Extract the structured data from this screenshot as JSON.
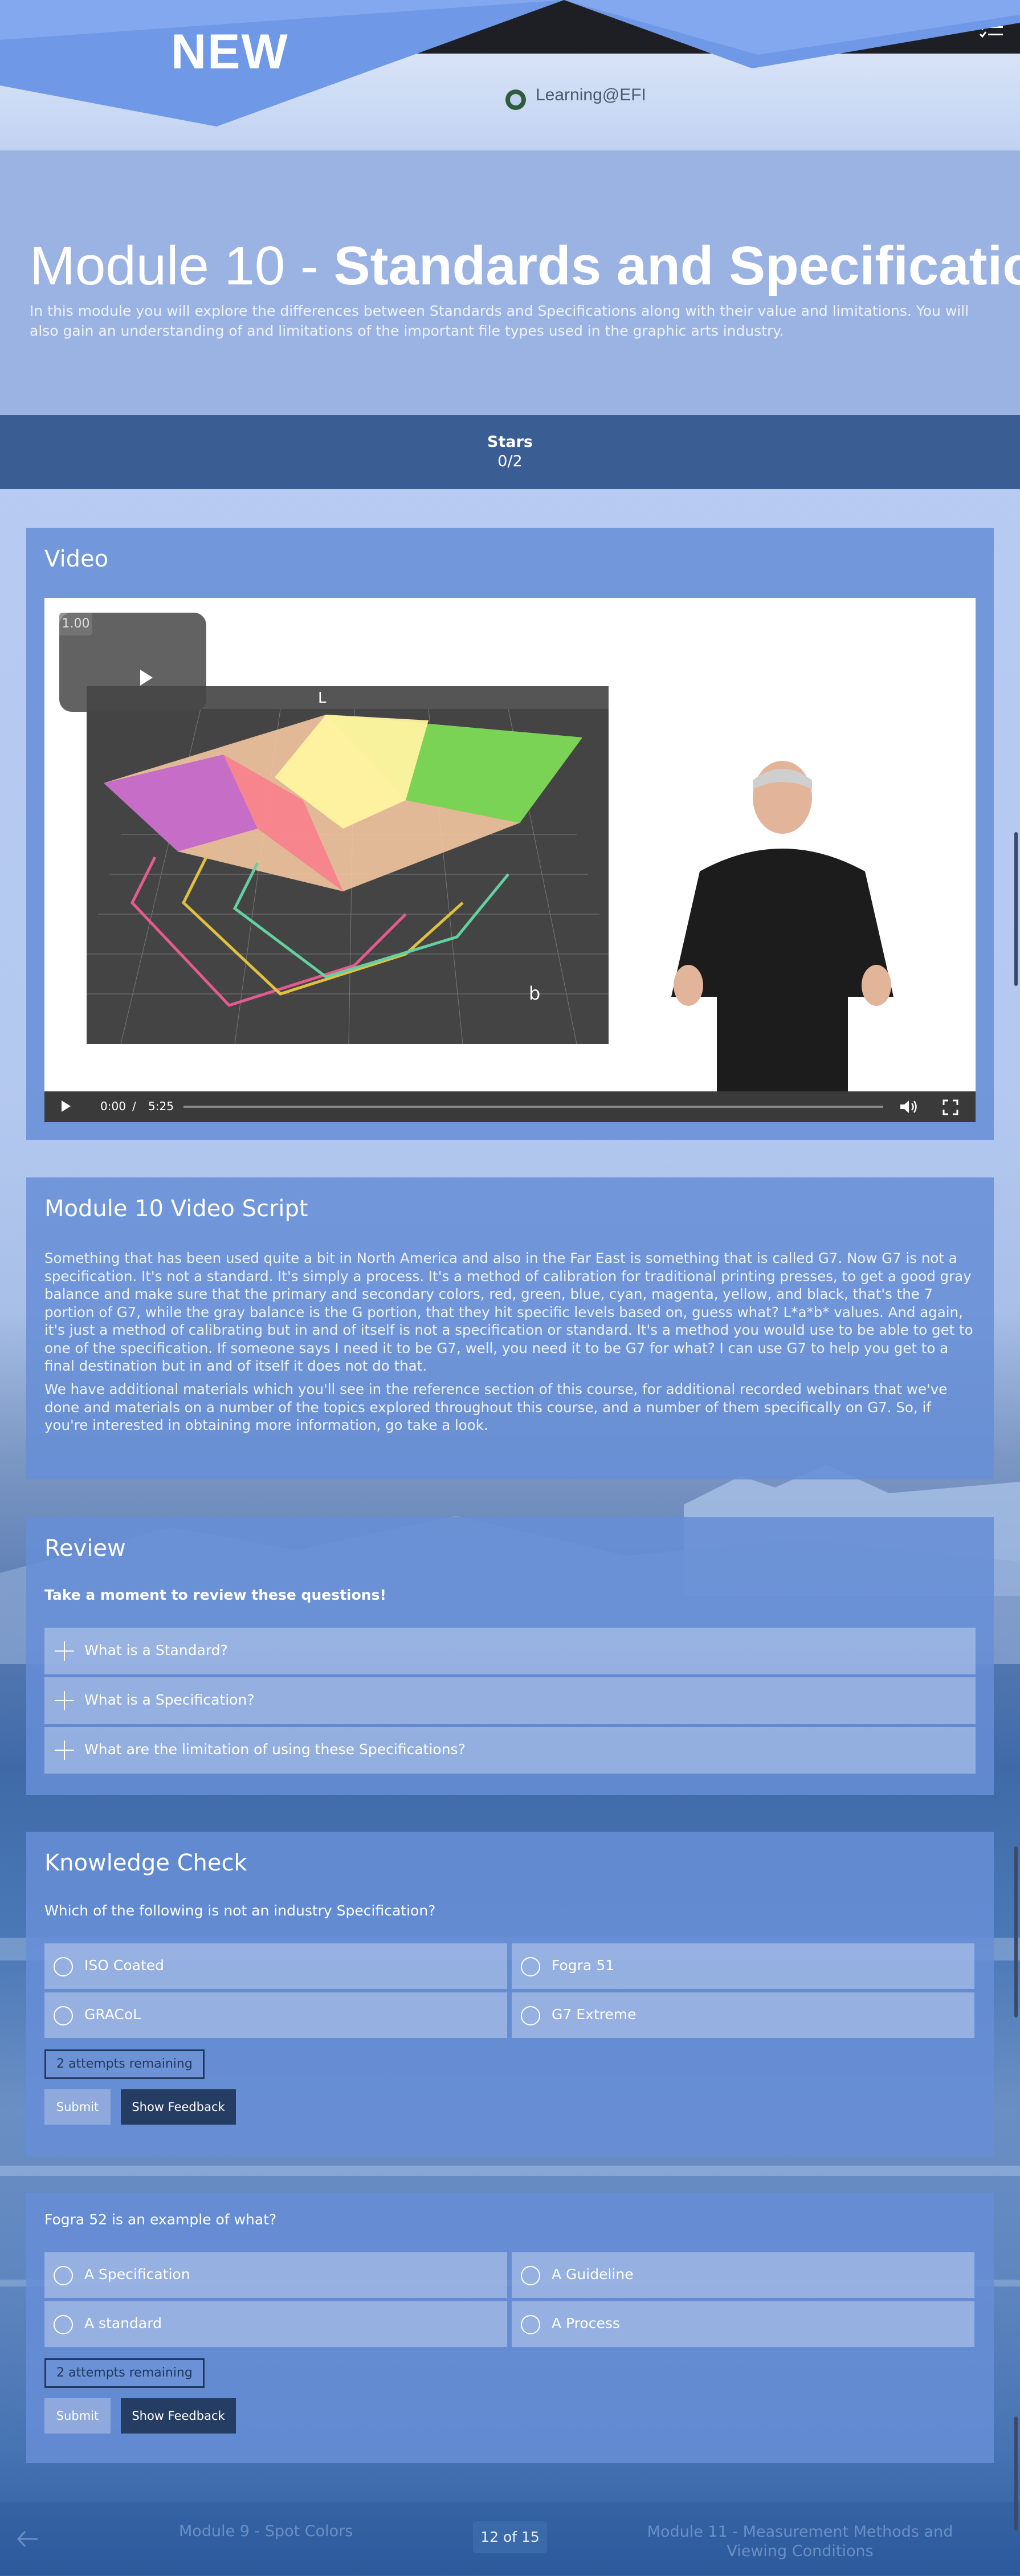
{
  "banner": {
    "label": "NEW"
  },
  "header": {
    "logo_text": "Learning@EFI"
  },
  "hero": {
    "title_prefix": "Module 10 - ",
    "title_main": "Standards and Specification",
    "description": "In this module you will explore the differences between Standards and Specifications along with their value and limitations. You will also gain an understanding of and limitations of the important file types used in the graphic arts industry."
  },
  "stars": {
    "label": "Stars",
    "value": "0/2"
  },
  "video": {
    "title": "Video",
    "speed": "1.00",
    "gamut_axis_top": "L",
    "gamut_axis_right": "b",
    "current_time": "0:00",
    "separator": "/",
    "duration": "5:25",
    "progress": 0
  },
  "script": {
    "title": "Module 10 Video Script",
    "paragraphs": [
      "Something that has been used quite a bit in North America and also in the Far East is something that is called G7. Now G7 is not a specification. It's not a standard. It's simply a process. It's a method of calibration for traditional printing presses, to get a good gray balance and make sure that the primary and secondary colors, red, green, blue, cyan, magenta, yellow, and black, that's the 7 portion of G7, while the gray balance is the G portion, that they hit specific levels based on, guess what? L*a*b* values. And again, it's just a method of calibrating but in and of itself is not a specification or standard. It's a method you would use to be able to get to one of the specification. If someone says I need it to be G7, well, you need it to be G7 for what? I can use G7 to help you get to a final destination but in and of itself it does not do that.",
      "We have additional materials which you'll see in the reference section of this course, for additional recorded webinars that we've done and materials on a number of the topics explored throughout this course, and a number of them specifically on G7. So, if you're interested in obtaining more information, go take a look."
    ]
  },
  "review": {
    "title": "Review",
    "intro": "Take a moment to review these questions!",
    "items": [
      "What is a Standard?",
      "What is a Specification?",
      "What are the limitation of using these Specifications?"
    ]
  },
  "knowledge_check": {
    "title": "Knowledge Check",
    "questions": [
      {
        "prompt": "Which of the following is not an industry Specification?",
        "options": [
          "ISO Coated",
          "Fogra 51",
          "GRACoL",
          "G7 Extreme"
        ],
        "attempts": "2 attempts remaining",
        "submit": "Submit",
        "feedback": "Show Feedback"
      },
      {
        "prompt": "Fogra 52 is an example of what?",
        "options": [
          "A Specification",
          "A Guideline",
          "A standard",
          "A Process"
        ],
        "attempts": "2 attempts remaining",
        "submit": "Submit",
        "feedback": "Show Feedback"
      }
    ]
  },
  "footer": {
    "prev": "Module 9 - Spot Colors",
    "page": "12 of 15",
    "next": "Module 11 - Measurement Methods and Viewing Conditions"
  },
  "colors": {
    "top_bar": "#1e1f24",
    "stars_bar": "#3a5d94",
    "panel": "#678ed6",
    "feedback_button": "#263d63",
    "submit_button": "#8fa9dd"
  },
  "icons": [
    "menu-icon",
    "bell-icon",
    "checklist-icon",
    "play-icon",
    "volume-icon",
    "fullscreen-icon",
    "plus-icon",
    "radio-icon",
    "arrow-left-icon"
  ]
}
